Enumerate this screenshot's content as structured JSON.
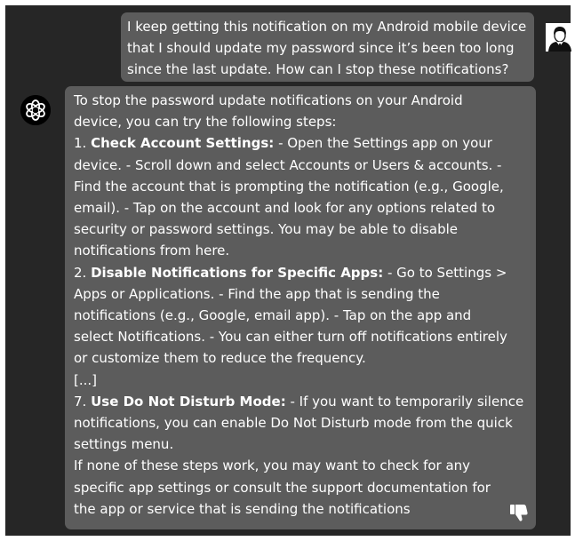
{
  "conversation": {
    "user_message": {
      "lines": [
        "I keep getting this notification on my Android mobile device",
        "that I should update my password since it’s been too long",
        "since the last update. How can I stop these notifications?"
      ]
    },
    "assistant_message": {
      "l01": "To stop the password update notifications on your Android",
      "l02": "device, you can try the following steps:",
      "l03_num": "1. ",
      "l03_bold": "Check Account Settings:",
      "l03_rest": " - Open the Settings app on your",
      "l04": "device. - Scroll down and select Accounts or Users & accounts. -",
      "l05": "Find the account that is prompting the notification (e.g., Google,",
      "l06": "email). - Tap on the account and look for any options related to",
      "l07": "security or password settings. You may be able to disable",
      "l08": "notifications from here.",
      "l09_num": "2. ",
      "l09_bold": "Disable Notifications for Specific Apps:",
      "l09_rest": " - Go to Settings >",
      "l10": "Apps or Applications. - Find the app that is sending the",
      "l11": "notifications (e.g., Google, email app). - Tap on the app and",
      "l12": "select Notifications. - You can either turn off notifications entirely",
      "l13": "or customize them to reduce the frequency.",
      "l14": "[...]",
      "l15_num": "7. ",
      "l15_bold": "Use Do Not Disturb Mode:",
      "l15_rest": " - If you want to temporarily silence",
      "l16": "notifications, you can enable Do Not Disturb mode from the quick",
      "l17": "settings menu.",
      "l18": "If none of these steps work, you may want to check for any",
      "l19": "specific app settings or consult the support documentation for",
      "l20": "the app or service that is sending the notifications"
    }
  },
  "icons": {
    "user_avatar": "user-avatar-icon",
    "assistant_avatar": "openai-logo-icon",
    "feedback": "thumbs-down-icon"
  },
  "colors": {
    "background": "#262626",
    "bubble": "#5c5c5c",
    "text": "#ffffff"
  }
}
